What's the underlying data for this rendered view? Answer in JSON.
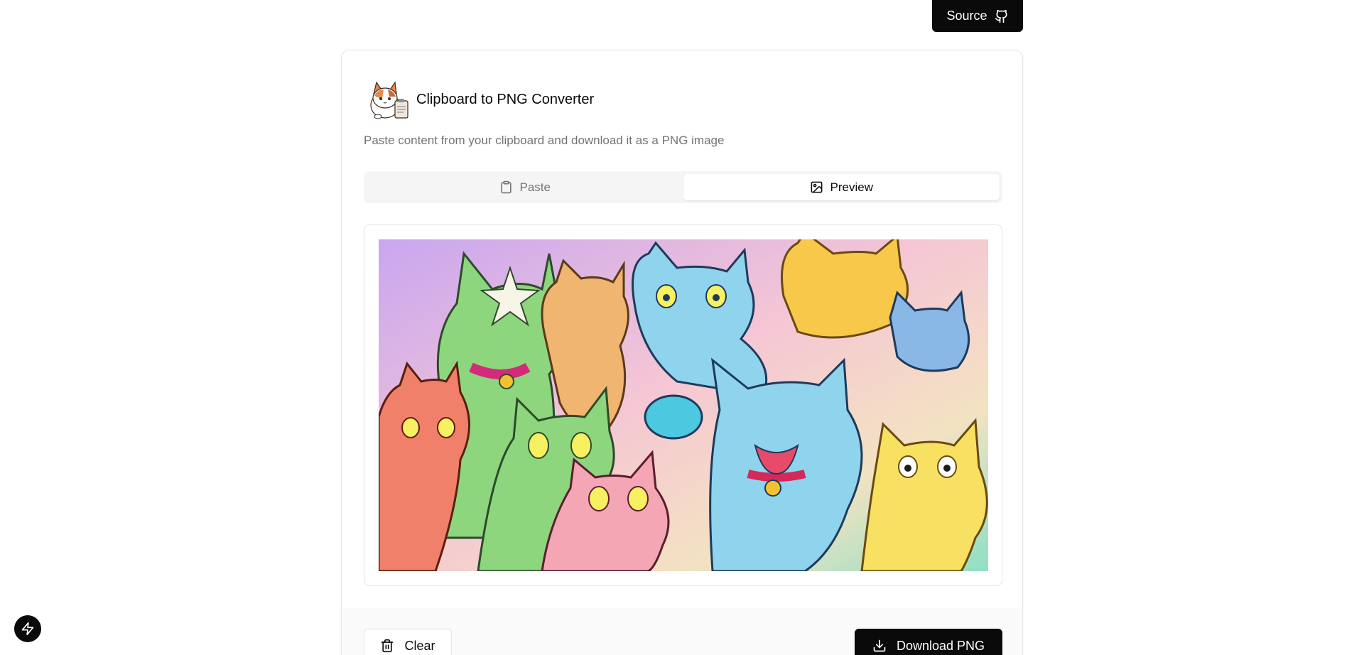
{
  "topbar": {
    "source_label": "Source",
    "source_icon": "github-icon"
  },
  "header": {
    "title": "Clipboard to PNG Converter",
    "subtitle": "Paste content from your clipboard and download it as a PNG image",
    "logo_icon": "cat-clipboard-logo"
  },
  "tabs": [
    {
      "label": "Paste",
      "icon": "clipboard-icon",
      "active": false
    },
    {
      "label": "Preview",
      "icon": "image-icon",
      "active": true
    }
  ],
  "footer": {
    "clear_label": "Clear",
    "clear_icon": "trash-icon",
    "download_label": "Download PNG",
    "download_icon": "download-icon"
  },
  "fab_icon": "lightning-icon",
  "colors": {
    "primary": "#0a0a0a",
    "muted": "#737373",
    "border": "#e5e5e5"
  }
}
